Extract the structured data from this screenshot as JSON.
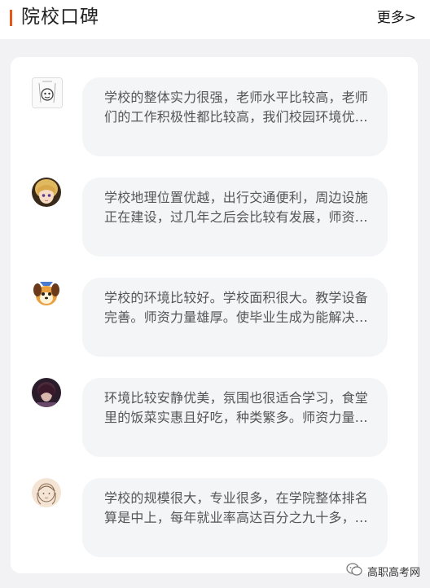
{
  "header": {
    "title": "院校口碑",
    "more_label": "更多>"
  },
  "colors": {
    "accent": "#e8571a",
    "bubble_bg": "#f4f5f7"
  },
  "reviews": [
    {
      "text": "学校的整体实力很强，老师水平比较高，老师们的工作积极性都比较高，我们校园环境优...",
      "avatar": "sketch-avatar-icon"
    },
    {
      "text": "学校地理位置优越，出行交通便利，周边设施正在建设，过几年之后会比较有发展，师资...",
      "avatar": "anime-girl-avatar-icon"
    },
    {
      "text": "学校的环境比较好。学校面积很大。教学设备完善。师资力量雄厚。使毕业生成为能解决...",
      "avatar": "cartoon-dog-avatar-icon"
    },
    {
      "text": "环境比较安静优美，氛围也很适合学习，食堂里的饭菜实惠且好吃，种类繁多。师资力量...",
      "avatar": "dark-portrait-avatar-icon"
    },
    {
      "text": "学校的规模很大，专业很多，在学院整体排名算是中上，每年就业率高达百分之九十多，...",
      "avatar": "sketch-girl-avatar-icon"
    }
  ],
  "watermark": {
    "label": "高职高考网",
    "icon": "wechat-icon"
  }
}
